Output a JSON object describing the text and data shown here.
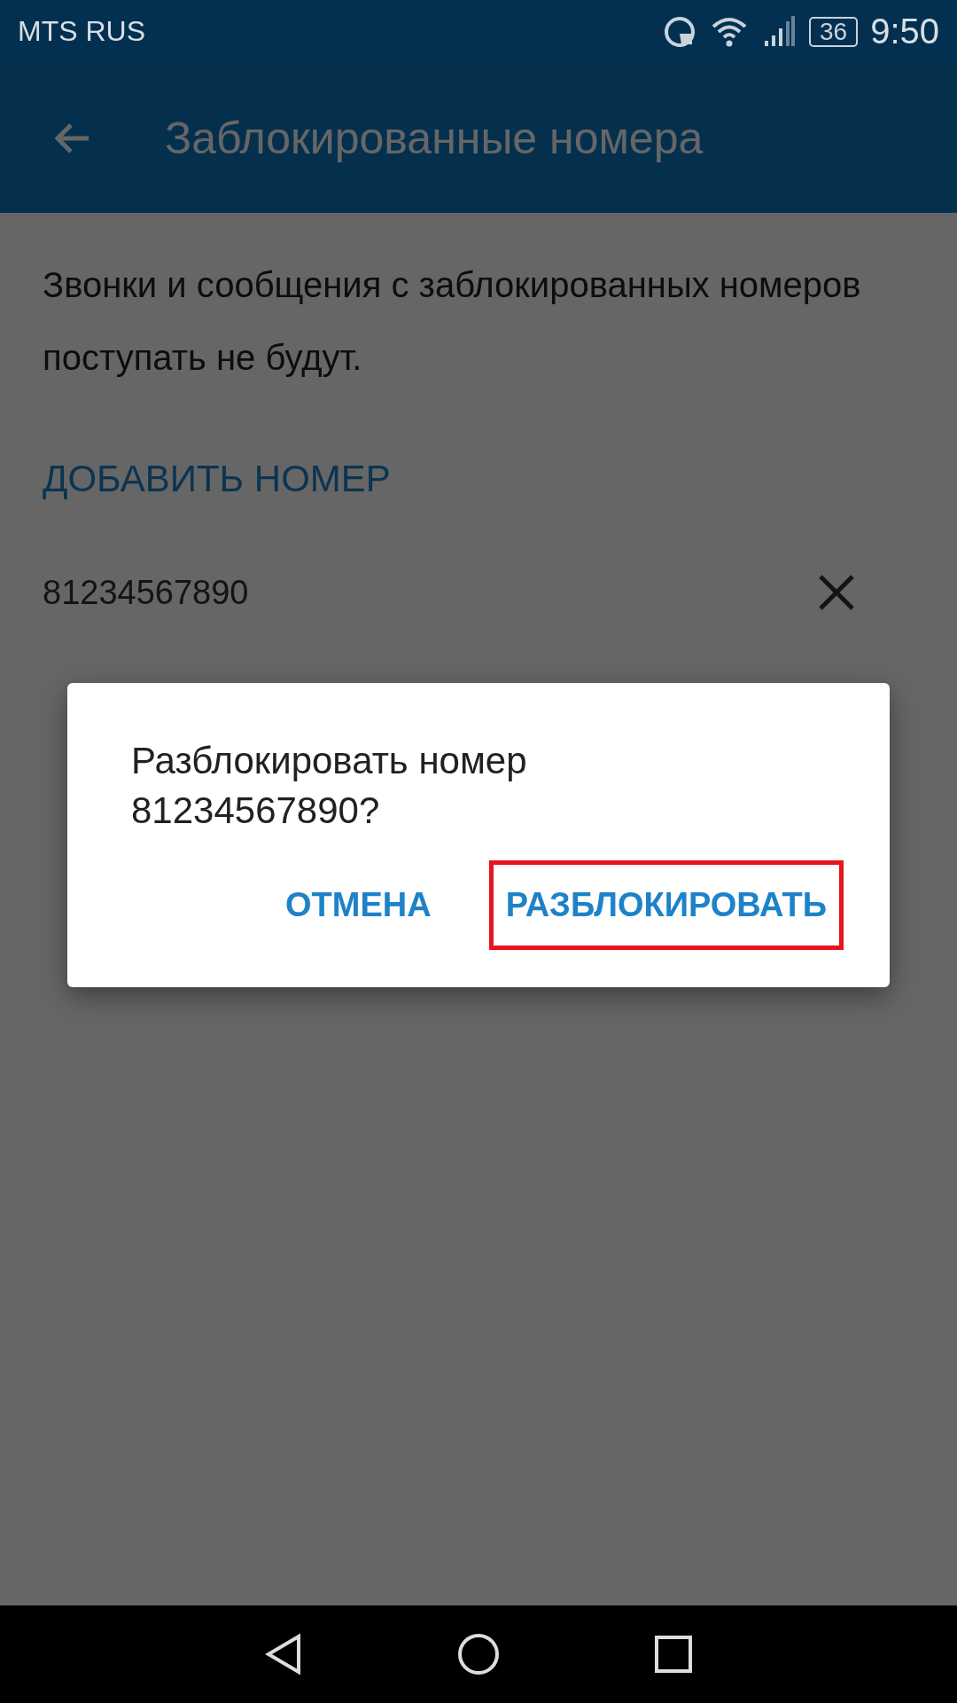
{
  "status_bar": {
    "carrier": "MTS RUS",
    "battery": "36",
    "time": "9:50"
  },
  "app_bar": {
    "title": "Заблокированные номера"
  },
  "description": "Звонки и сообщения с заблокированных номеров поступать не будут.",
  "add_button": "ДОБАВИТЬ НОМЕР",
  "blocked_numbers": [
    {
      "number": "81234567890"
    }
  ],
  "dialog": {
    "message": "Разблокировать номер 81234567890?",
    "actions": [
      {
        "label": "ОТМЕНА",
        "highlighted": false
      },
      {
        "label": "РАЗБЛОКИРОВАТЬ",
        "highlighted": true
      }
    ]
  }
}
